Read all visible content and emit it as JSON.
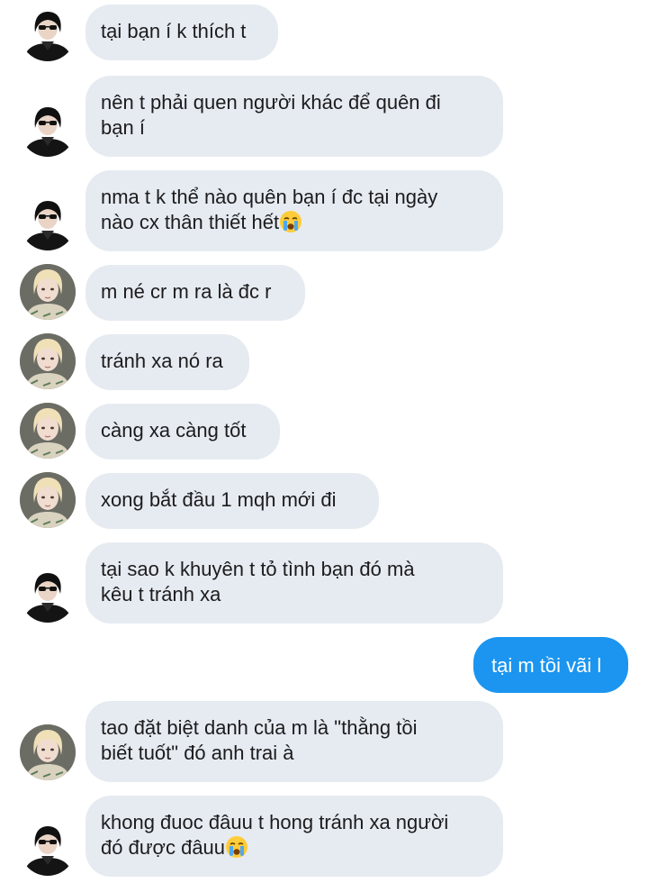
{
  "colors": {
    "incoming_bubble": "#e6ebf1",
    "outgoing_bubble": "#1b95ef",
    "incoming_text": "#1c1c1e",
    "outgoing_text": "#ffffff"
  },
  "messages": [
    {
      "sender": "contact_a",
      "avatar": "dark-haired-person-avatar",
      "lines": [
        "tại bạn í k thích t"
      ]
    },
    {
      "sender": "contact_a",
      "avatar": "dark-haired-person-avatar",
      "lines": [
        "nên t phải quen người khác để quên đi",
        "bạn í"
      ]
    },
    {
      "sender": "contact_a",
      "avatar": "dark-haired-person-avatar",
      "lines": [
        "nma t k thể nào quên bạn í đc tại ngày",
        "nào cx thân thiết hết"
      ],
      "emoji": "crying-face"
    },
    {
      "sender": "contact_b",
      "avatar": "blond-person-avatar",
      "lines": [
        "m né cr m ra là đc r"
      ]
    },
    {
      "sender": "contact_b",
      "avatar": "blond-person-avatar",
      "lines": [
        "tránh xa nó ra"
      ]
    },
    {
      "sender": "contact_b",
      "avatar": "blond-person-avatar",
      "lines": [
        "càng xa càng tốt"
      ]
    },
    {
      "sender": "contact_b",
      "avatar": "blond-person-avatar",
      "lines": [
        "xong bắt đầu 1 mqh mới đi"
      ]
    },
    {
      "sender": "contact_a",
      "avatar": "dark-haired-person-avatar",
      "lines": [
        "tại sao k khuyên t tỏ tình bạn đó mà",
        "kêu t tránh xa"
      ]
    },
    {
      "sender": "me",
      "lines": [
        "tại m tồi vãi l"
      ]
    },
    {
      "sender": "contact_b",
      "avatar": "blond-person-avatar",
      "lines": [
        "tao đặt biệt danh của m là \"thằng tồi",
        "biết tuốt\" đó anh trai à"
      ]
    },
    {
      "sender": "contact_a",
      "avatar": "dark-haired-person-avatar",
      "lines": [
        "khong đuoc đâuu t hong tránh xa người",
        "đó được đâuu"
      ],
      "emoji": "crying-face"
    }
  ]
}
